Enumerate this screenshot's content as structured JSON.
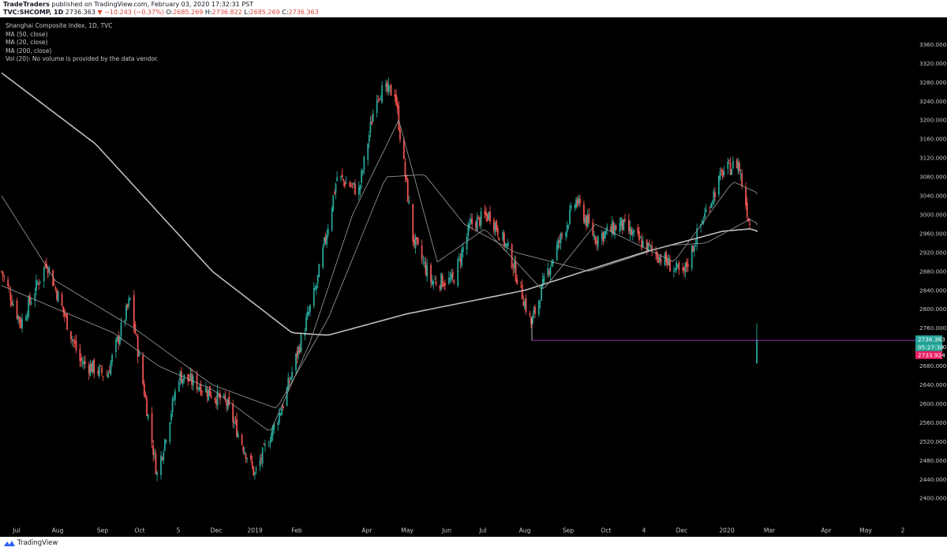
{
  "header": {
    "author": "TradeTraders",
    "published": "published on TradingView.com, February 03, 2020 17:32:31 PST",
    "symbol": "TVC:SHCOMP, 1D",
    "last": "2736.363",
    "change": "▼ −10.243 (−0.37%)",
    "o_label": "O:",
    "o_value": "2685.269",
    "h_label": "H:",
    "h_value": "2736.822",
    "l_label": "L:",
    "l_value": "2685.269",
    "c_label": "C:",
    "c_value": "2736.363"
  },
  "legend": {
    "title": "Shanghai Composite Index, 1D, TVC",
    "ma50": "MA (50, close)",
    "ma20": "MA (20, close)",
    "ma200": "MA (200, close)",
    "vol": "Vol (20): No volume is provided by the data vendor."
  },
  "footer": {
    "brand": "TradingView"
  },
  "colors": {
    "background": "#000000",
    "up_candle": "#26a69a",
    "down_candle": "#ef5350",
    "ma_line": "#9e9e9e",
    "horizontal_line": "#9c27b0",
    "last_price_tag": "#26a69a",
    "countdown_tag": "#26a69a",
    "line_price_tag": "#e91e63",
    "axis_text": "#c8c8c8"
  },
  "chart_data": {
    "type": "candlestick",
    "title": "Shanghai Composite Index, 1D, TVC",
    "x_tick_labels": [
      "Jul",
      "Aug",
      "Sep",
      "Oct",
      "5",
      "Dec",
      "2019",
      "Feb",
      "Apr",
      "May",
      "Jun",
      "Jul",
      "Aug",
      "Sep",
      "Oct",
      "4",
      "Dec",
      "2020",
      "Mar",
      "Apr",
      "May",
      "2"
    ],
    "y_tick_labels": [
      "2400.000",
      "2440.000",
      "2480.000",
      "2520.000",
      "2560.000",
      "2600.000",
      "2640.000",
      "2680.000",
      "2720.000",
      "2760.000",
      "2800.000",
      "2840.000",
      "2880.000",
      "2920.000",
      "2960.000",
      "3000.000",
      "3040.000",
      "3080.000",
      "3120.000",
      "3160.000",
      "3200.000",
      "3240.000",
      "3280.000",
      "3320.000",
      "3360.000"
    ],
    "ylim": [
      2390,
      3380
    ],
    "grid": false,
    "price_path_keypoints": [
      {
        "date": "2018-06-20",
        "close": 2880
      },
      {
        "date": "2018-07-05",
        "close": 2770
      },
      {
        "date": "2018-07-25",
        "close": 2900
      },
      {
        "date": "2018-08-20",
        "close": 2690
      },
      {
        "date": "2018-09-10",
        "close": 2660
      },
      {
        "date": "2018-09-28",
        "close": 2820
      },
      {
        "date": "2018-10-19",
        "close": 2450
      },
      {
        "date": "2018-11-05",
        "close": 2660
      },
      {
        "date": "2018-11-20",
        "close": 2640
      },
      {
        "date": "2018-12-12",
        "close": 2600
      },
      {
        "date": "2019-01-03",
        "close": 2450
      },
      {
        "date": "2019-01-25",
        "close": 2600
      },
      {
        "date": "2019-02-20",
        "close": 2850
      },
      {
        "date": "2019-03-08",
        "close": 3080
      },
      {
        "date": "2019-03-25",
        "close": 3050
      },
      {
        "date": "2019-04-08",
        "close": 3260
      },
      {
        "date": "2019-04-22",
        "close": 3260
      },
      {
        "date": "2019-05-06",
        "close": 2950
      },
      {
        "date": "2019-05-20",
        "close": 2860
      },
      {
        "date": "2019-06-06",
        "close": 2860
      },
      {
        "date": "2019-06-20",
        "close": 2980
      },
      {
        "date": "2019-07-05",
        "close": 3000
      },
      {
        "date": "2019-07-20",
        "close": 2920
      },
      {
        "date": "2019-08-06",
        "close": 2770
      },
      {
        "date": "2019-08-20",
        "close": 2890
      },
      {
        "date": "2019-09-10",
        "close": 3030
      },
      {
        "date": "2019-09-25",
        "close": 2950
      },
      {
        "date": "2019-10-15",
        "close": 2980
      },
      {
        "date": "2019-10-31",
        "close": 2940
      },
      {
        "date": "2019-11-15",
        "close": 2910
      },
      {
        "date": "2019-12-02",
        "close": 2870
      },
      {
        "date": "2019-12-16",
        "close": 2980
      },
      {
        "date": "2020-01-02",
        "close": 3090
      },
      {
        "date": "2020-01-14",
        "close": 3110
      },
      {
        "date": "2020-01-23",
        "close": 2980
      },
      {
        "date": "2020-02-03",
        "close": 2736.363
      }
    ],
    "moving_averages": [
      {
        "name": "MA (200, close)",
        "points": [
          {
            "date": "2018-06-20",
            "value": 3300
          },
          {
            "date": "2018-09-01",
            "value": 3150
          },
          {
            "date": "2018-12-01",
            "value": 2880
          },
          {
            "date": "2019-02-01",
            "value": 2750
          },
          {
            "date": "2019-03-01",
            "value": 2745
          },
          {
            "date": "2019-05-01",
            "value": 2790
          },
          {
            "date": "2019-08-01",
            "value": 2840
          },
          {
            "date": "2019-11-01",
            "value": 2920
          },
          {
            "date": "2020-01-02",
            "value": 2965
          },
          {
            "date": "2020-01-23",
            "value": 2970
          },
          {
            "date": "2020-02-03",
            "value": 2962
          }
        ]
      },
      {
        "name": "MA (50, close)",
        "points": [
          {
            "date": "2018-06-20",
            "value": 3040
          },
          {
            "date": "2018-08-01",
            "value": 2860
          },
          {
            "date": "2018-10-01",
            "value": 2760
          },
          {
            "date": "2018-12-01",
            "value": 2640
          },
          {
            "date": "2019-01-20",
            "value": 2590
          },
          {
            "date": "2019-03-01",
            "value": 2780
          },
          {
            "date": "2019-04-15",
            "value": 3080
          },
          {
            "date": "2019-05-15",
            "value": 3085
          },
          {
            "date": "2019-06-15",
            "value": 2980
          },
          {
            "date": "2019-07-25",
            "value": 2920
          },
          {
            "date": "2019-09-20",
            "value": 2880
          },
          {
            "date": "2019-11-20",
            "value": 2935
          },
          {
            "date": "2019-12-20",
            "value": 2940
          },
          {
            "date": "2020-01-23",
            "value": 2990
          },
          {
            "date": "2020-02-03",
            "value": 2975
          }
        ]
      },
      {
        "name": "MA (20, close)",
        "points": [
          {
            "date": "2018-06-20",
            "value": 2850
          },
          {
            "date": "2018-09-15",
            "value": 2750
          },
          {
            "date": "2018-10-20",
            "value": 2680
          },
          {
            "date": "2018-12-01",
            "value": 2630
          },
          {
            "date": "2019-01-15",
            "value": 2540
          },
          {
            "date": "2019-02-15",
            "value": 2730
          },
          {
            "date": "2019-03-20",
            "value": 3000
          },
          {
            "date": "2019-04-25",
            "value": 3200
          },
          {
            "date": "2019-05-25",
            "value": 2900
          },
          {
            "date": "2019-07-01",
            "value": 2970
          },
          {
            "date": "2019-08-15",
            "value": 2840
          },
          {
            "date": "2019-09-25",
            "value": 2980
          },
          {
            "date": "2019-11-25",
            "value": 2900
          },
          {
            "date": "2020-01-10",
            "value": 3070
          },
          {
            "date": "2020-02-03",
            "value": 3040
          }
        ]
      }
    ],
    "horizontal_line": {
      "value": 2733.924
    },
    "price_tags": {
      "last": "2736.363",
      "countdown": "05:27:30",
      "line": "2733.924"
    }
  }
}
